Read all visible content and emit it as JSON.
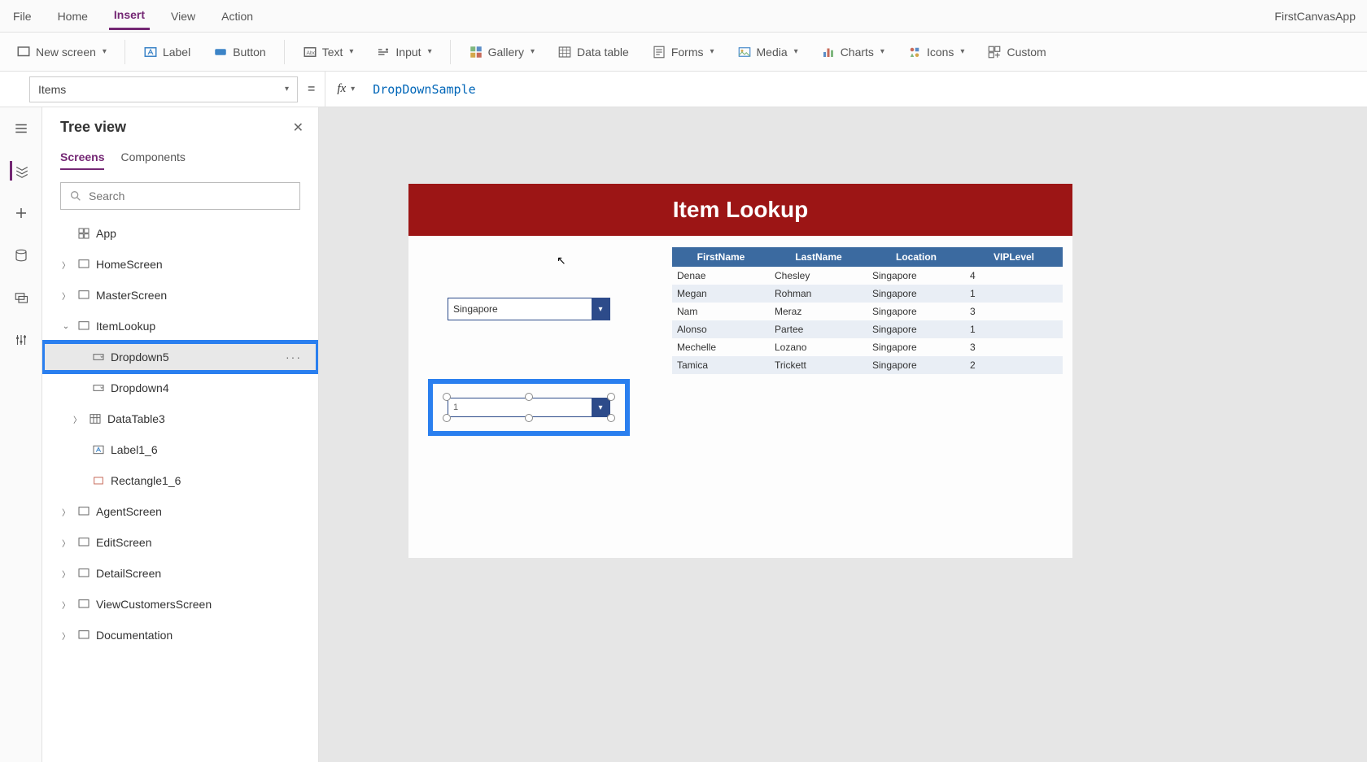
{
  "menubar": {
    "items": [
      "File",
      "Home",
      "Insert",
      "View",
      "Action"
    ],
    "active": "Insert",
    "app_title": "FirstCanvasApp"
  },
  "ribbon": {
    "new_screen": "New screen",
    "label": "Label",
    "button": "Button",
    "text": "Text",
    "input": "Input",
    "gallery": "Gallery",
    "data_table": "Data table",
    "forms": "Forms",
    "media": "Media",
    "charts": "Charts",
    "icons": "Icons",
    "custom": "Custom"
  },
  "formula": {
    "property": "Items",
    "equals": "=",
    "fx": "fx",
    "value": "DropDownSample"
  },
  "tree": {
    "title": "Tree view",
    "tabs": {
      "screens": "Screens",
      "components": "Components"
    },
    "search_placeholder": "Search",
    "app": "App",
    "items": {
      "home": "HomeScreen",
      "master": "MasterScreen",
      "itemlookup": "ItemLookup",
      "dropdown5": "Dropdown5",
      "dropdown4": "Dropdown4",
      "datatable3": "DataTable3",
      "label1_6": "Label1_6",
      "rectangle1_6": "Rectangle1_6",
      "agent": "AgentScreen",
      "edit": "EditScreen",
      "detail": "DetailScreen",
      "viewcust": "ViewCustomersScreen",
      "docs": "Documentation"
    },
    "more": "···"
  },
  "canvas": {
    "title": "Item Lookup",
    "dd1_value": "Singapore",
    "dd2_value": "1",
    "table": {
      "headers": [
        "FirstName",
        "LastName",
        "Location",
        "VIPLevel"
      ],
      "rows": [
        [
          "Denae",
          "Chesley",
          "Singapore",
          "4"
        ],
        [
          "Megan",
          "Rohman",
          "Singapore",
          "1"
        ],
        [
          "Nam",
          "Meraz",
          "Singapore",
          "3"
        ],
        [
          "Alonso",
          "Partee",
          "Singapore",
          "1"
        ],
        [
          "Mechelle",
          "Lozano",
          "Singapore",
          "3"
        ],
        [
          "Tamica",
          "Trickett",
          "Singapore",
          "2"
        ]
      ]
    }
  }
}
